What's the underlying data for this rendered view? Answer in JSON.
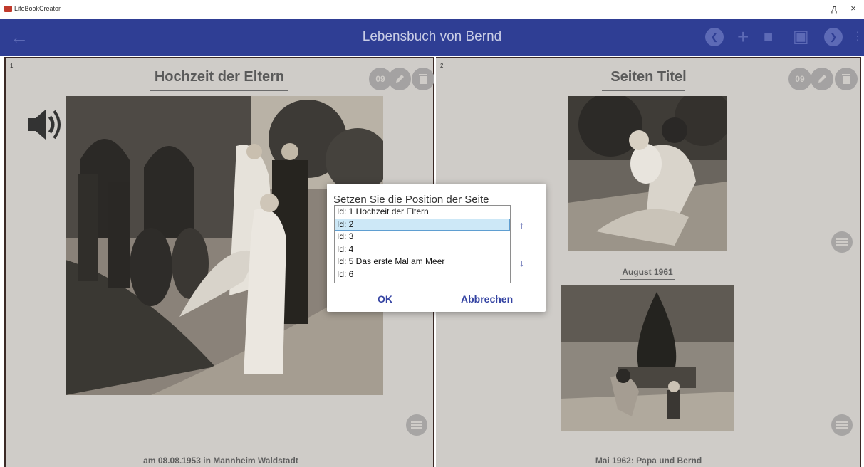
{
  "window": {
    "title": "LifeBookCreator",
    "minimize_glyph": "–",
    "maximize_glyph": "д",
    "close_glyph": "×"
  },
  "appbar": {
    "title": "Lebensbuch von Bernd",
    "back_icon": "←",
    "actions": [
      {
        "name": "previous-icon",
        "glyph": "❮"
      },
      {
        "name": "add-icon",
        "glyph": "+"
      },
      {
        "name": "delete-icon",
        "glyph": "■"
      },
      {
        "name": "book-icon",
        "glyph": "▣"
      },
      {
        "name": "next-icon",
        "glyph": "❯"
      },
      {
        "name": "more-icon",
        "glyph": "⋮"
      }
    ]
  },
  "pages": {
    "left": {
      "number": "1",
      "title": "Hochzeit der Eltern",
      "badge": "09",
      "caption": "am 08.08.1953 in Mannheim Waldstadt"
    },
    "right": {
      "number": "2",
      "title": "Seiten Titel",
      "badge": "09",
      "caption_top": "August 1961",
      "caption_bottom": "Mai 1962: Papa und Bernd"
    }
  },
  "dialog": {
    "title": "Setzen Sie die Position der Seite",
    "items": [
      "Id: 1 Hochzeit der Eltern",
      "Id: 2",
      "Id: 3",
      "Id: 4",
      "Id: 5 Das erste Mal am Meer",
      "Id: 6"
    ],
    "selected_index": 1,
    "up_glyph": "↑",
    "down_glyph": "↓",
    "ok_label": "OK",
    "cancel_label": "Abbrechen"
  },
  "colors": {
    "appbar": "#2f3e94",
    "page_bg": "#cfccc8",
    "dialog_button": "#3443a2",
    "selection": "#cde8f7"
  }
}
